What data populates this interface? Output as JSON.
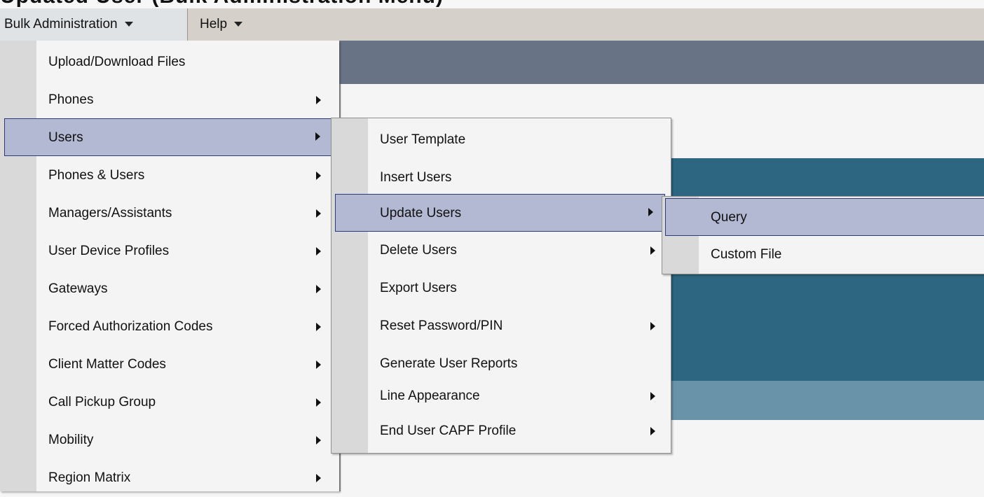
{
  "top_strip": {
    "clipped_text": "Updated User (Bulk Administration Menu)"
  },
  "menubar": {
    "items": [
      {
        "label": "Bulk Administration"
      },
      {
        "label": "Help"
      }
    ]
  },
  "bulk_menu": {
    "items": [
      {
        "label": "Upload/Download Files",
        "has_submenu": false
      },
      {
        "label": "Phones",
        "has_submenu": true
      },
      {
        "label": "Users",
        "has_submenu": true,
        "selected": true
      },
      {
        "label": "Phones & Users",
        "has_submenu": true
      },
      {
        "label": "Managers/Assistants",
        "has_submenu": true
      },
      {
        "label": "User Device Profiles",
        "has_submenu": true
      },
      {
        "label": "Gateways",
        "has_submenu": true
      },
      {
        "label": "Forced Authorization Codes",
        "has_submenu": true
      },
      {
        "label": "Client Matter Codes",
        "has_submenu": true
      },
      {
        "label": "Call Pickup Group",
        "has_submenu": true
      },
      {
        "label": "Mobility",
        "has_submenu": true
      },
      {
        "label": "Region Matrix",
        "has_submenu": true
      }
    ]
  },
  "users_submenu": {
    "items": [
      {
        "label": "User Template",
        "has_submenu": false
      },
      {
        "label": "Insert Users",
        "has_submenu": false
      },
      {
        "label": "Update Users",
        "has_submenu": true,
        "selected": true
      },
      {
        "label": "Delete Users",
        "has_submenu": true
      },
      {
        "label": "Export Users",
        "has_submenu": false
      },
      {
        "label": "Reset Password/PIN",
        "has_submenu": true
      },
      {
        "label": "Generate User Reports",
        "has_submenu": false
      },
      {
        "label": "Line Appearance",
        "has_submenu": true
      },
      {
        "label": "End User CAPF Profile",
        "has_submenu": true
      }
    ]
  },
  "update_users_submenu": {
    "items": [
      {
        "label": "Query",
        "selected": true
      },
      {
        "label": "Custom File"
      }
    ]
  },
  "colors": {
    "selection_fill": "#b3b8d3",
    "selection_border": "#2a3d7a",
    "menubar_bg": "#d5d0ca",
    "teal": "#2d6680",
    "slate": "#687385"
  }
}
